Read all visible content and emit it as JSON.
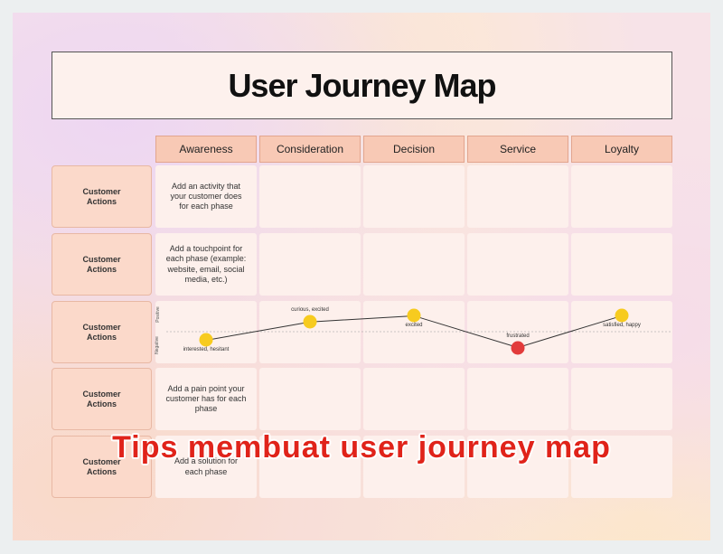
{
  "title": "User Journey Map",
  "phases": [
    "Awareness",
    "Consideration",
    "Decision",
    "Service",
    "Loyalty"
  ],
  "rows": [
    {
      "label": "Customer Actions",
      "first_cell": "Add an activity that your customer does for each phase"
    },
    {
      "label": "Customer Actions",
      "first_cell": "Add a touchpoint for each phase (example: website, email, social media, etc.)"
    },
    {
      "label": "Customer Actions",
      "first_cell": ""
    },
    {
      "label": "Customer Actions",
      "first_cell": "Add a pain point your customer has for each phase"
    },
    {
      "label": "Customer Actions",
      "first_cell": "Add a solution for each phase"
    }
  ],
  "emotion": {
    "positive_label": "Positive",
    "negative_label": "Negative",
    "points": [
      {
        "label": "interested, hesitant",
        "level": -0.35,
        "icon": "neutral-face-icon",
        "color": "#f7cb1f"
      },
      {
        "label": "curious, excited",
        "level": 0.4,
        "icon": "grinning-face-icon",
        "color": "#f7cb1f"
      },
      {
        "label": "excited",
        "level": 0.65,
        "icon": "smiling-face-icon",
        "color": "#f7cb1f"
      },
      {
        "label": "frustrated",
        "level": -0.65,
        "icon": "angry-face-icon",
        "color": "#e23b3b"
      },
      {
        "label": "satisfied, happy",
        "level": 0.65,
        "icon": "heart-eyes-face-icon",
        "color": "#f7cb1f"
      }
    ]
  },
  "watermark": "Tips membuat user journey map"
}
